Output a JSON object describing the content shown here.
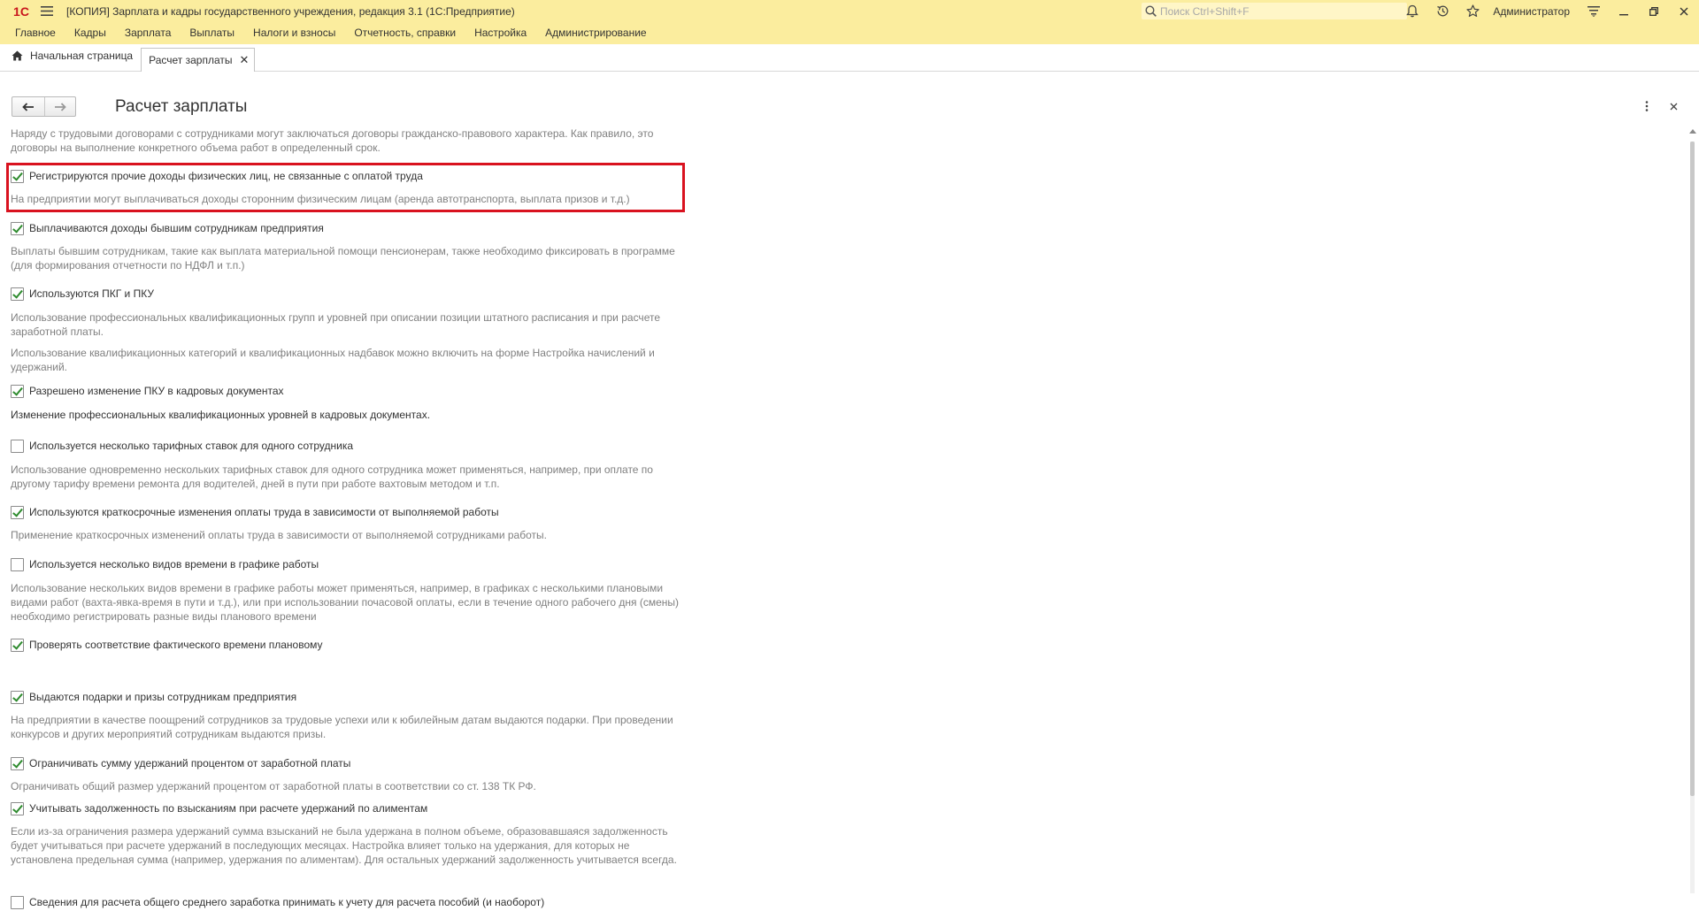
{
  "titlebar": {
    "logo": "1С",
    "title": "[КОПИЯ] Зарплата и кадры государственного учреждения, редакция 3.1  (1С:Предприятие)",
    "search_placeholder": "Поиск Ctrl+Shift+F",
    "user": "Администратор"
  },
  "menu": {
    "items": [
      "Главное",
      "Кадры",
      "Зарплата",
      "Выплаты",
      "Налоги и взносы",
      "Отчетность, справки",
      "Настройка",
      "Администрирование"
    ]
  },
  "tabs": {
    "home_label": "Начальная страница",
    "active_label": "Расчет зарплаты"
  },
  "form": {
    "title": "Расчет зарплаты"
  },
  "content": {
    "intro": "Наряду с трудовыми договорами с сотрудниками могут заключаться договоры гражданско-правового характера. Как правило, это договоры на выполнение конкретного объема работ в определенный срок.",
    "items": [
      {
        "label": "Регистрируются прочие доходы физических лиц, не связанные с оплатой труда",
        "checked": true,
        "desc": [
          "На предприятии могут выплачиваться доходы сторонним физическим лицам (аренда автотранспорта, выплата призов и т.д.)"
        ]
      },
      {
        "label": "Выплачиваются доходы бывшим сотрудникам предприятия",
        "checked": true,
        "desc": [
          "Выплаты бывшим сотрудникам, такие как выплата материальной помощи пенсионерам, также необходимо фиксировать в программе (для формирования отчетности по НДФЛ и т.п.)"
        ]
      },
      {
        "label": "Используются ПКГ и ПКУ",
        "checked": true,
        "desc": [
          "Использование профессиональных квалификационных групп и уровней при описании позиции штатного расписания и при расчете заработной платы.",
          "Использование квалификационных категорий и квалификационных надбавок можно включить на форме Настройка начислений и удержаний."
        ]
      },
      {
        "label": "Разрешено изменение ПКУ в кадровых документах",
        "checked": true,
        "desc": [
          "Изменение профессиональных квалификационных уровней в кадровых документах."
        ]
      },
      {
        "label": "Используется несколько тарифных ставок для одного сотрудника",
        "checked": false,
        "desc": [
          "Использование одновременно нескольких тарифных ставок для одного сотрудника может применяться, например, при оплате по другому тарифу времени ремонта для водителей, дней в пути при работе вахтовым методом и т.п."
        ]
      },
      {
        "label": "Используются краткосрочные изменения оплаты труда в зависимости от выполняемой работы",
        "checked": true,
        "desc": [
          "Применение краткосрочных изменений оплаты труда в зависимости от выполняемой сотрудниками работы."
        ]
      },
      {
        "label": "Используется несколько видов времени в графике работы",
        "checked": false,
        "desc": [
          "Использование нескольких видов времени в графике работы может применяться, например, в графиках с несколькими плановыми видами работ (вахта-явка-время в пути и т.д.), или при использовании почасовой оплаты, если в течение одного рабочего дня (смены) необходимо регистрировать разные виды планового времени"
        ]
      },
      {
        "label": "Проверять соответствие фактического времени плановому",
        "checked": true,
        "desc": []
      },
      {
        "label": "Выдаются подарки и призы сотрудникам предприятия",
        "checked": true,
        "desc": [
          "На предприятии в качестве поощрений сотрудников за трудовые успехи или к юбилейным датам выдаются подарки. При проведении конкурсов и других мероприятий сотрудникам выдаются призы."
        ]
      },
      {
        "label": "Ограничивать сумму удержаний процентом от заработной платы",
        "checked": true,
        "desc": [
          "Ограничивать общий размер удержаний процентом от заработной платы в соответствии со ст. 138 ТК РФ."
        ]
      },
      {
        "label": "Учитывать задолженность по взысканиям при расчете удержаний по алиментам",
        "checked": true,
        "desc": [
          "Если из-за ограничения размера удержаний сумма взысканий не была удержана в полном объеме, образовавшаяся задолженность будет учитываться при расчете удержаний в последующих месяцах. Настройка влияет только на удержания, для которых не установлена предельная сумма (например, удержания по алиментам). Для остальных удержаний задолженность учитывается всегда."
        ]
      },
      {
        "label": "Сведения для расчета общего среднего заработка принимать к учету для расчета пособий (и наоборот)",
        "checked": false,
        "desc": []
      }
    ]
  },
  "colors": {
    "accent_bar": "#fbed9e",
    "highlight_border": "#d9121f",
    "check_mark": "#2e8b2e"
  }
}
